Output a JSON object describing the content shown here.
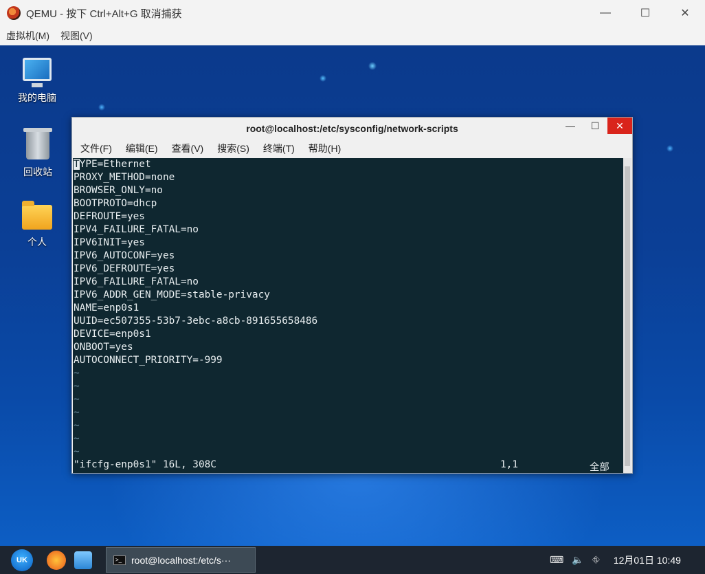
{
  "host": {
    "title": "QEMU - 按下 Ctrl+Alt+G 取消捕获",
    "controls": {
      "minimize": "—",
      "maximize": "☐",
      "close": "✕"
    },
    "menu": [
      "虚拟机(M)",
      "视图(V)"
    ]
  },
  "desktop": {
    "icons": [
      {
        "label": "我的电脑",
        "icon": "computer-icon"
      },
      {
        "label": "回收站",
        "icon": "trash-icon"
      },
      {
        "label": "个人",
        "icon": "home-folder-icon"
      }
    ]
  },
  "terminal": {
    "title": "root@localhost:/etc/sysconfig/network-scripts",
    "controls": {
      "minimize": "—",
      "maximize": "☐",
      "close": "✕"
    },
    "menu": [
      "文件(F)",
      "编辑(E)",
      "查看(V)",
      "搜索(S)",
      "终端(T)",
      "帮助(H)"
    ],
    "cursor_char": "T",
    "first_line_rest": "YPE=Ethernet",
    "lines": [
      "PROXY_METHOD=none",
      "BROWSER_ONLY=no",
      "BOOTPROTO=dhcp",
      "DEFROUTE=yes",
      "IPV4_FAILURE_FATAL=no",
      "IPV6INIT=yes",
      "IPV6_AUTOCONF=yes",
      "IPV6_DEFROUTE=yes",
      "IPV6_FAILURE_FATAL=no",
      "IPV6_ADDR_GEN_MODE=stable-privacy",
      "NAME=enp0s1",
      "UUID=ec507355-53b7-3ebc-a8cb-891655658486",
      "DEVICE=enp0s1",
      "ONBOOT=yes",
      "AUTOCONNECT_PRIORITY=-999"
    ],
    "tildes": [
      "~",
      "~",
      "~",
      "~",
      "~",
      "~",
      "~"
    ],
    "status": {
      "file": "\"ifcfg-enp0s1\" 16L, 308C",
      "position": "1,1",
      "view": "全部"
    }
  },
  "taskbar": {
    "start_label": "UK",
    "task_label": "root@localhost:/etc/s···",
    "clock": "12月01日 10:49"
  }
}
